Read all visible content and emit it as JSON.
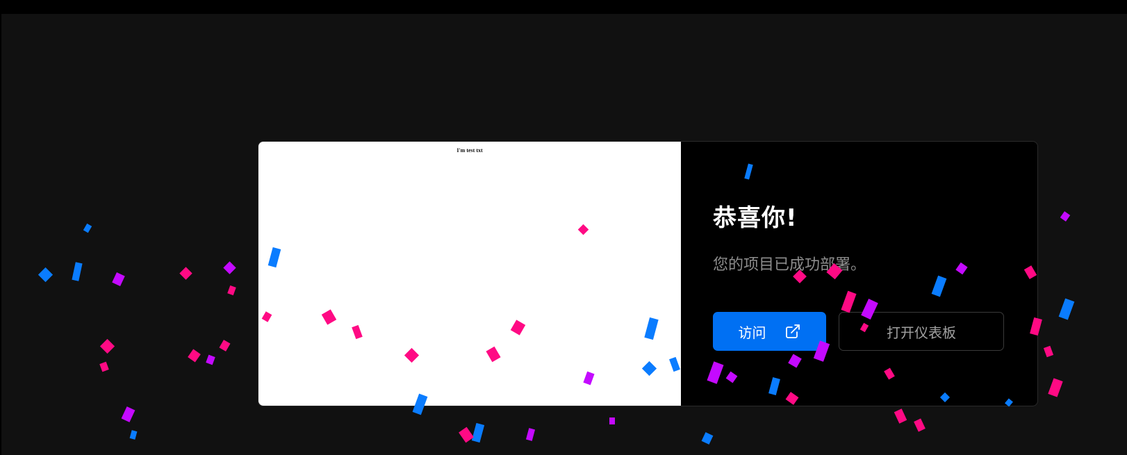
{
  "preview": {
    "text": "I'm test txt"
  },
  "panel": {
    "title": "恭喜你!",
    "subtitle": "您的项目已成功部署。",
    "visit_label": "访问",
    "dashboard_label": "打开仪表板"
  },
  "icons": {
    "visit": "external-link-icon"
  },
  "colors": {
    "background": "#111111",
    "accent": "#0070f3",
    "confetti": [
      "#ff0a84",
      "#0a7cff",
      "#c40aff"
    ]
  }
}
